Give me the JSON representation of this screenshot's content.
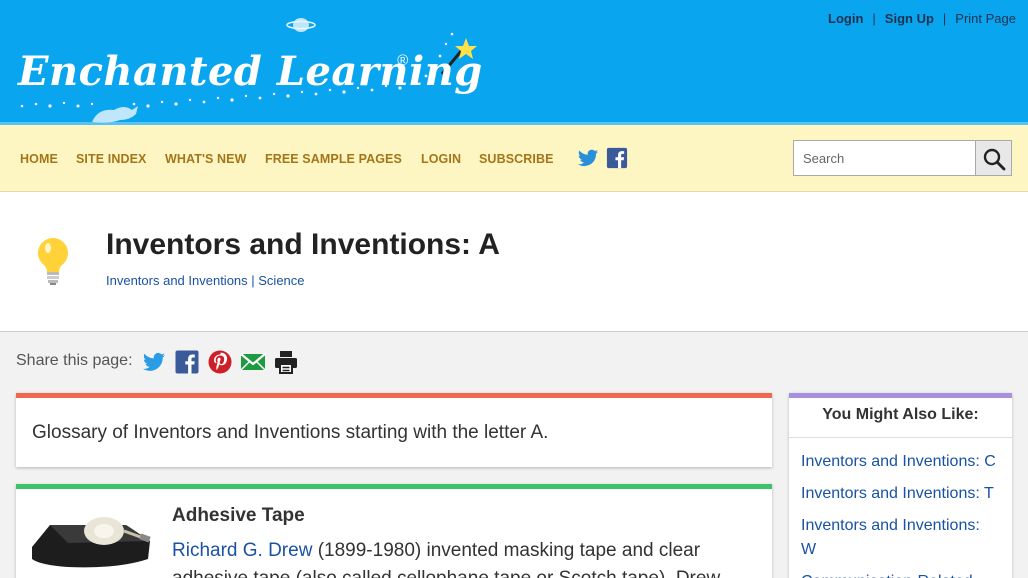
{
  "header": {
    "logo_text": "Enchanted Learning",
    "logo_reg": "®",
    "top_links": {
      "login": "Login",
      "signup": "Sign Up",
      "print": "Print Page",
      "sep": "|"
    }
  },
  "nav": {
    "items": [
      "HOME",
      "SITE INDEX",
      "WHAT'S NEW",
      "FREE SAMPLE PAGES",
      "LOGIN",
      "SUBSCRIBE"
    ],
    "search_placeholder": "Search",
    "social": [
      "twitter-icon",
      "facebook-icon"
    ]
  },
  "page": {
    "title": "Inventors and Inventions: A",
    "breadcrumb": {
      "part1": "Inventors and Inventions",
      "sep": " | ",
      "part2": "Science"
    }
  },
  "share": {
    "label": "Share this page:",
    "icons": [
      "twitter-icon",
      "facebook-icon",
      "pinterest-icon",
      "email-icon",
      "print-icon"
    ]
  },
  "intro": {
    "text": "Glossary of Inventors and Inventions starting with the letter A."
  },
  "entry": {
    "title": "Adhesive Tape",
    "inventor": "Richard G. Drew",
    "body_line1": " (1899-1980) invented masking tape and clear",
    "body_line2": "adhesive tape (also called cellophane tape or Scotch tape). Drew"
  },
  "sidebar": {
    "title": "You Might Also Like:",
    "links": [
      "Inventors and Inventions: C",
      "Inventors and Inventions: T",
      "Inventors and Inventions: W",
      "Communication-Related"
    ]
  },
  "colors": {
    "header_bg": "#0aa5ef",
    "nav_bg": "#fdf6c3",
    "nav_text": "#a5751a",
    "link": "#1a52a3",
    "intro_accent": "#ef6a4d",
    "entry_accent": "#3cc26a",
    "sidebar_accent": "#a88fe0"
  }
}
